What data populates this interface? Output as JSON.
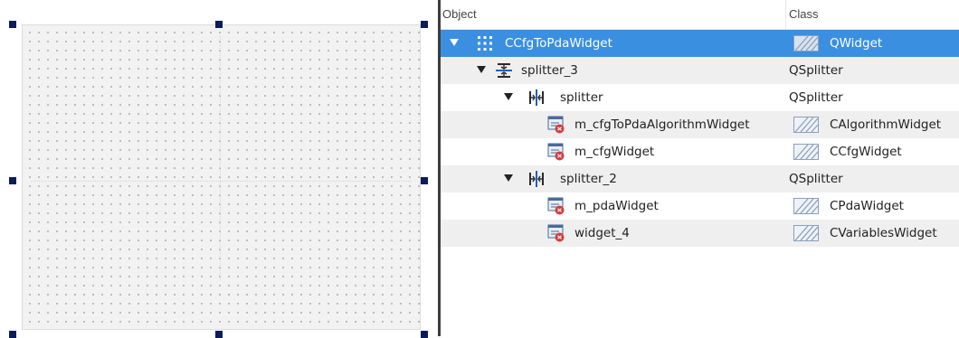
{
  "inspector": {
    "header": {
      "object": "Object",
      "class": "Class"
    },
    "rows": [
      {
        "name": "CCfgToPdaWidget",
        "class": "QWidget",
        "selected": true,
        "expanded": true
      },
      {
        "name": "splitter_3",
        "class": "QSplitter",
        "expanded": true
      },
      {
        "name": "splitter",
        "class": "QSplitter",
        "expanded": true
      },
      {
        "name": "m_cfgToPdaAlgorithmWidget",
        "class": "CAlgorithmWidget"
      },
      {
        "name": "m_cfgWidget",
        "class": "CCfgWidget"
      },
      {
        "name": "splitter_2",
        "class": "QSplitter",
        "expanded": true
      },
      {
        "name": "m_pdaWidget",
        "class": "CPdaWidget"
      },
      {
        "name": "widget_4",
        "class": "CVariablesWidget"
      }
    ]
  },
  "colors": {
    "selection": "#3b8fe0",
    "alternate_row": "#efefef",
    "handle": "#0b1c5c",
    "divider": "#3c3c3c"
  },
  "icons": {
    "form": "grid-layout-icon",
    "vertical_splitter": "vertical-splitter-icon",
    "horizontal_splitter": "horizontal-splitter-icon",
    "promoted_widget": "promoted-widget-icon",
    "class": "hatched-widget-class-icon"
  }
}
